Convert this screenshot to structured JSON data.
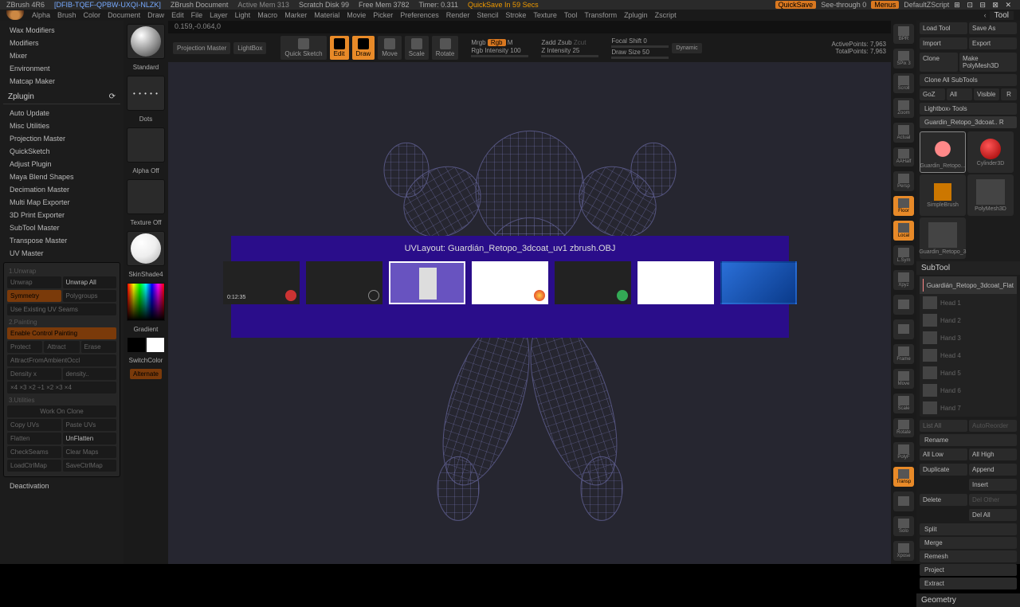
{
  "title": {
    "app": "ZBrush 4R6",
    "doc": "[DFIB-TQEF-QPBW-UXQI-NLZK]",
    "docLabel": "ZBrush Document",
    "mem": "Active Mem 313",
    "scratch": "Scratch Disk 99",
    "freemem": "Free Mem 3782",
    "timer": "Timer: 0.311",
    "quicksave": "QuickSave In 59 Secs",
    "qsBtn": "QuickSave",
    "seethrough": "See-through  0",
    "menus": "Menus",
    "script": "DefaultZScript"
  },
  "menu": [
    "Alpha",
    "Brush",
    "Color",
    "Document",
    "Draw",
    "Edit",
    "File",
    "Layer",
    "Light",
    "Macro",
    "Marker",
    "Material",
    "Movie",
    "Picker",
    "Preferences",
    "Render",
    "Stencil",
    "Stroke",
    "Texture",
    "Tool",
    "Transform",
    "Zplugin",
    "Zscript"
  ],
  "coords": "0.159,-0.064,0",
  "topbar": {
    "proj": "Projection Master",
    "lightbox": "LightBox",
    "quicksketch": "Quick Sketch",
    "edit": "Edit",
    "draw": "Draw",
    "move": "Move",
    "scale": "Scale",
    "rotate": "Rotate",
    "mrgb": "Mrgb",
    "rgb": "Rgb",
    "m": "M",
    "rgbint": "Rgb Intensity 100",
    "zadd": "Zadd",
    "zsub": "Zsub",
    "zcut": "Zcut",
    "zint": "Z Intensity 25",
    "focal": "Focal Shift 0",
    "drawsize": "Draw Size 50",
    "dynamic": "Dynamic",
    "active": "ActivePoints: 7,963",
    "total": "TotalPoints: 7,963"
  },
  "leftMenu": {
    "items1": [
      "Wax Modifiers",
      "Modifiers",
      "Mixer",
      "Environment",
      "Matcap Maker"
    ],
    "zplugin": "Zplugin",
    "items2": [
      "Auto Update",
      "Misc Utilities",
      "Projection Master",
      "QuickSketch",
      "Adjust Plugin",
      "Maya Blend Shapes",
      "Decimation Master",
      "Multi Map Exporter",
      "3D Print Exporter",
      "SubTool Master",
      "Transpose Master",
      "UV Master"
    ],
    "unwrap": {
      "sect": "1.Unwrap",
      "unwrap": "Unwrap",
      "unwrapAll": "Unwrap All",
      "sym": "Symmetry",
      "poly": "Polygroups",
      "existing": "Use Existing UV Seams"
    },
    "paint": {
      "sect": "2.Painting",
      "enable": "Enable Control Painting",
      "protect": "Protect",
      "attract": "Attract",
      "erase": "Erase",
      "ambient": "AttractFromAmbientOccl",
      "density": "Density  x",
      "densval": "density..",
      "clear": "×4 ×3 ×2 ÷1  ×2 ×3 ×4"
    },
    "util": {
      "sect": "3.Utilities",
      "clone": "Work On Clone",
      "copy": "Copy UVs",
      "paste": "Paste UVs",
      "flatten": "Flatten",
      "unflatten": "UnFlatten",
      "check": "CheckSeams",
      "clear": "Clear Maps",
      "load": "LoadCtrlMap",
      "save": "SaveCtrlMap"
    },
    "deact": "Deactivation"
  },
  "toolcol": {
    "standard": "Standard",
    "dots": "Dots",
    "alpha": "Alpha Off",
    "texture": "Texture Off",
    "skin": "SkinShade4",
    "gradient": "Gradient",
    "switch": "SwitchColor",
    "alternate": "Alternate"
  },
  "rightTools": [
    "BPR",
    "SPix 3",
    "Scroll",
    "Zoom",
    "Actual",
    "AAHalf",
    "Persp",
    "Floor",
    "Local",
    "L.Sym",
    "Xpyz",
    "",
    "",
    "Frame",
    "Move",
    "Scale",
    "Rotate",
    "PolyF",
    "Transp",
    "",
    "Solo",
    "Xpose"
  ],
  "tool": {
    "header": "Tool",
    "load": "Load Tool",
    "saveas": "Save As",
    "import": "Import",
    "export": "Export",
    "clone": "Clone",
    "makepoly": "Make PolyMesh3D",
    "cloneall": "Clone All SubTools",
    "goz": "GoZ",
    "all": "All",
    "visible": "Visible",
    "r": "R",
    "lightbox": "Lightbox› Tools",
    "current": "Guardin_Retopo_3dcoat..  R",
    "thumbs": [
      {
        "n": "Guardin_Retopo..."
      },
      {
        "n": "Cylinder3D"
      },
      {
        "n": "SimpleBrush"
      },
      {
        "n": "PolyMesh3D"
      },
      {
        "n": "Guardin_Retopo_3"
      }
    ],
    "subtool": "SubTool",
    "strow": "Guardián_Retopo_3dcoat_Flat",
    "slots": [
      "Head 1",
      "Hand 2",
      "Hand 3",
      "Head 4",
      "Hand 5",
      "Hand 6",
      "Hand 7"
    ],
    "listall": "List All",
    "autoreorder": "AutoReorder",
    "rename": "Rename",
    "alllow": "All Low",
    "allhigh": "All High",
    "duplicate": "Duplicate",
    "append": "Append",
    "insert": "Insert",
    "delete": "Delete",
    "delother": "Del Other",
    "delall": "Del All",
    "split": "Split",
    "merge": "Merge",
    "remesh": "Remesh",
    "project": "Project",
    "extract": "Extract",
    "geometry": "Geometry"
  },
  "overlay": {
    "title": "UVLayout: Guardián_Retopo_3dcoat_uv1 zbrush.OBJ",
    "timestamp": "0:12:35"
  }
}
